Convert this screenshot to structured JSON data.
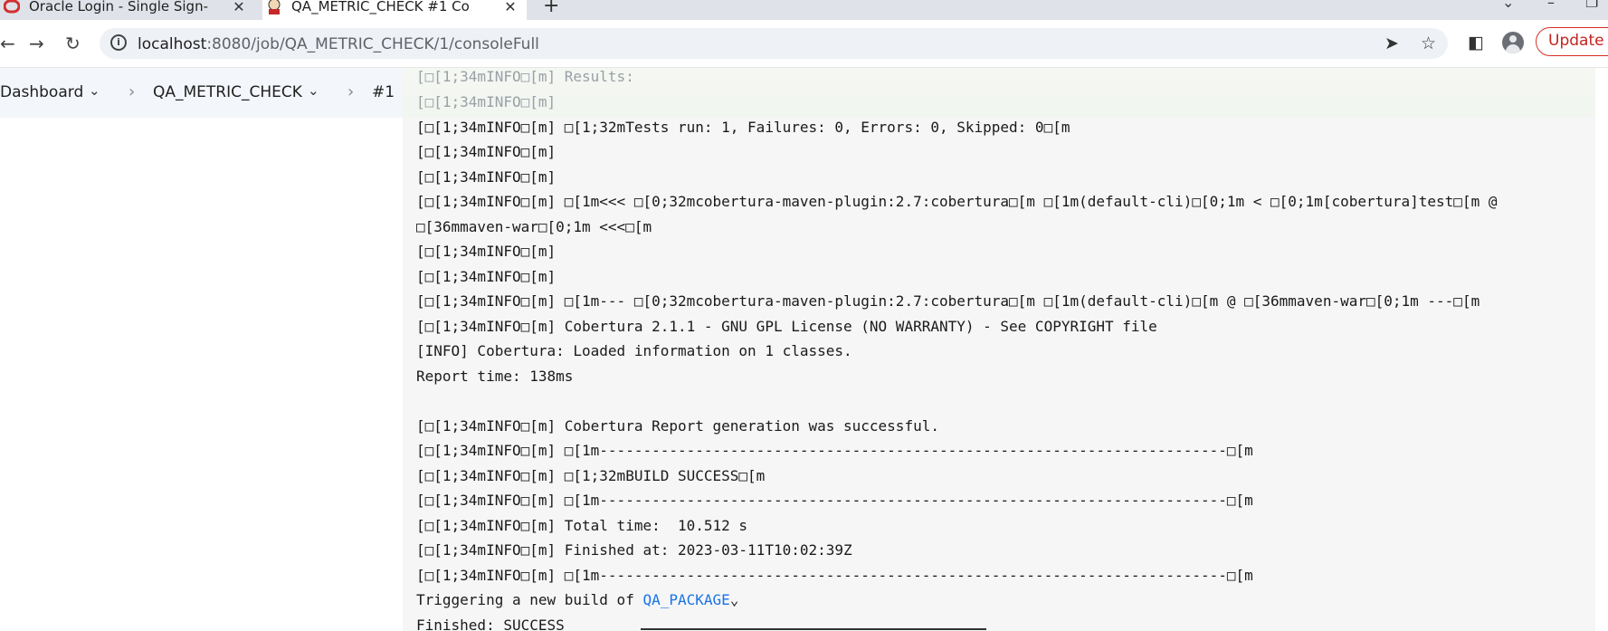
{
  "browser": {
    "tabs": [
      {
        "title": "Oracle Login - Single Sign-",
        "active": false
      },
      {
        "title": "QA_METRIC_CHECK #1 Co",
        "active": true
      }
    ],
    "new_tab_icon": "plus-icon",
    "url_host": "localhost",
    "url_rest": ":8080/job/QA_METRIC_CHECK/1/consoleFull",
    "update_label": "Update",
    "accent_color": "#d93025"
  },
  "breadcrumb": {
    "items": [
      "Dashboard",
      "QA_METRIC_CHECK",
      "#1"
    ]
  },
  "console": {
    "lines": [
      "[□[1;34mINFO□[m] Results:",
      "[□[1;34mINFO□[m]",
      "[□[1;34mINFO□[m] □[1;32mTests run: 1, Failures: 0, Errors: 0, Skipped: 0□[m",
      "[□[1;34mINFO□[m]",
      "[□[1;34mINFO□[m]",
      "[□[1;34mINFO□[m] □[1m<<< □[0;32mcobertura-maven-plugin:2.7:cobertura□[m □[1m(default-cli)□[0;1m < □[0;1m[cobertura]test□[m @",
      "□[36mmaven-war□[0;1m <<<□[m",
      "[□[1;34mINFO□[m]",
      "[□[1;34mINFO□[m]",
      "[□[1;34mINFO□[m] □[1m--- □[0;32mcobertura-maven-plugin:2.7:cobertura□[m □[1m(default-cli)□[m @ □[36mmaven-war□[0;1m ---□[m",
      "[□[1;34mINFO□[m] Cobertura 2.1.1 - GNU GPL License (NO WARRANTY) - See COPYRIGHT file",
      "[INFO] Cobertura: Loaded information on 1 classes.",
      "Report time: 138ms",
      "",
      "[□[1;34mINFO□[m] Cobertura Report generation was successful.",
      "[□[1;34mINFO□[m] □[1m------------------------------------------------------------------------□[m",
      "[□[1;34mINFO□[m] □[1;32mBUILD SUCCESS□[m",
      "[□[1;34mINFO□[m] □[1m------------------------------------------------------------------------□[m",
      "[□[1;34mINFO□[m] Total time:  10.512 s",
      "[□[1;34mINFO□[m] Finished at: 2023-03-11T10:02:39Z",
      "[□[1;34mINFO□[m] □[1m------------------------------------------------------------------------□[m"
    ],
    "trigger_prefix": "Triggering a new build of ",
    "trigger_link": "QA_PACKAGE",
    "finished": "Finished: SUCCESS",
    "link_color": "#1a73e8"
  }
}
